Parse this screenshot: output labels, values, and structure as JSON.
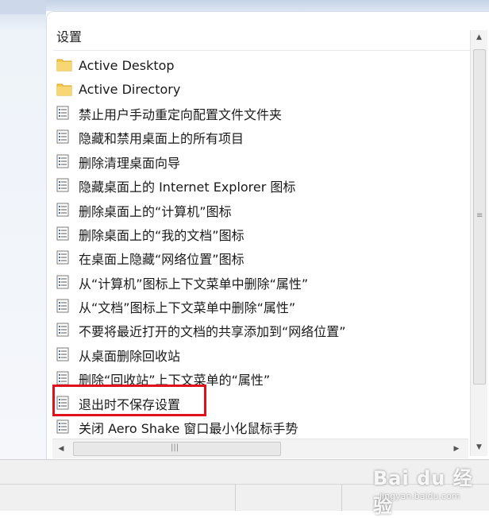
{
  "list": {
    "column_header": "设置",
    "items": [
      {
        "type": "folder",
        "label": "Active Desktop"
      },
      {
        "type": "folder",
        "label": "Active Directory"
      },
      {
        "type": "setting",
        "label": "禁止用户手动重定向配置文件文件夹"
      },
      {
        "type": "setting",
        "label": "隐藏和禁用桌面上的所有项目"
      },
      {
        "type": "setting",
        "label": "删除清理桌面向导"
      },
      {
        "type": "setting",
        "label": "隐藏桌面上的 Internet Explorer 图标"
      },
      {
        "type": "setting",
        "label": "删除桌面上的“计算机”图标"
      },
      {
        "type": "setting",
        "label": "删除桌面上的“我的文档”图标"
      },
      {
        "type": "setting",
        "label": "在桌面上隐藏“网络位置”图标"
      },
      {
        "type": "setting",
        "label": "从“计算机”图标上下文菜单中删除“属性”"
      },
      {
        "type": "setting",
        "label": "从“文档”图标上下文菜单中删除“属性”"
      },
      {
        "type": "setting",
        "label": "不要将最近打开的文档的共享添加到“网络位置”"
      },
      {
        "type": "setting",
        "label": "从桌面删除回收站"
      },
      {
        "type": "setting",
        "label": "删除“回收站”上下文菜单的“属性”"
      },
      {
        "type": "setting",
        "label": "退出时不保存设置",
        "highlighted": true
      },
      {
        "type": "setting",
        "label": "关闭 Aero Shake 窗口最小化鼠标手势"
      }
    ]
  },
  "watermark": {
    "text": "Bai du 经验",
    "sub": "jingyan.baidu.com"
  },
  "colors": {
    "highlight": "#e0101c",
    "folder": "#f2c94c",
    "panel_bg": "#ffffff"
  },
  "icons": {
    "folder": "folder-icon",
    "setting": "policy-setting-icon"
  }
}
